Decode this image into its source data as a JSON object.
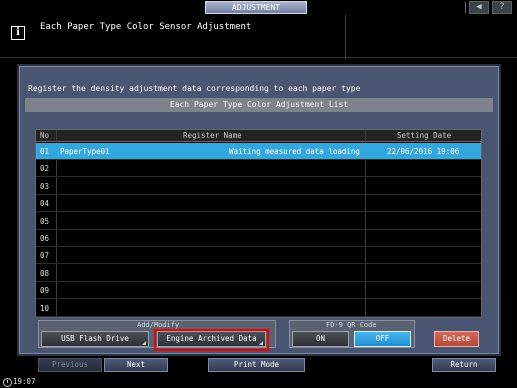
{
  "header": {
    "screen_title": "ADJUSTMENT",
    "icon_volume": "speaker-icon",
    "icon_help": "help-icon",
    "help_label": "?"
  },
  "message": {
    "icon": "info-icon",
    "icon_glyph": "i",
    "title": "Each Paper Type Color Sensor Adjustment"
  },
  "main": {
    "instruction": "Register the density adjustment data corresponding to each paper type",
    "list_title": "Each Paper Type Color Adjustment List",
    "columns": {
      "no": "No",
      "name": "Register Name",
      "date": "Setting Date"
    },
    "rows": [
      {
        "no": "01",
        "name": "PaperType01",
        "status": "Waiting measured data loading",
        "date": "22/06/2016 19:06",
        "selected": true
      },
      {
        "no": "02",
        "name": "",
        "status": "",
        "date": ""
      },
      {
        "no": "03",
        "name": "",
        "status": "",
        "date": ""
      },
      {
        "no": "04",
        "name": "",
        "status": "",
        "date": ""
      },
      {
        "no": "05",
        "name": "",
        "status": "",
        "date": ""
      },
      {
        "no": "06",
        "name": "",
        "status": "",
        "date": ""
      },
      {
        "no": "07",
        "name": "",
        "status": "",
        "date": ""
      },
      {
        "no": "08",
        "name": "",
        "status": "",
        "date": ""
      },
      {
        "no": "09",
        "name": "",
        "status": "",
        "date": ""
      },
      {
        "no": "10",
        "name": "",
        "status": "",
        "date": ""
      }
    ]
  },
  "add_modify": {
    "label": "Add/Modify",
    "usb_label": "USB Flash Drive",
    "engine_label": "Engine Archived Data"
  },
  "fd9": {
    "label": "FD-9 QR Code",
    "on_label": "ON",
    "off_label": "OFF",
    "selected": "OFF"
  },
  "delete_label": "Delete",
  "footer": {
    "previous_label": "Previous",
    "next_label": "Next",
    "print_mode_label": "Print Mode",
    "return_label": "Return"
  },
  "status": {
    "time": "19:07"
  },
  "colors": {
    "selected_row": "#33a6dd",
    "panel": "#4a5571",
    "delete": "#c25a49",
    "highlight": "#e00000"
  }
}
